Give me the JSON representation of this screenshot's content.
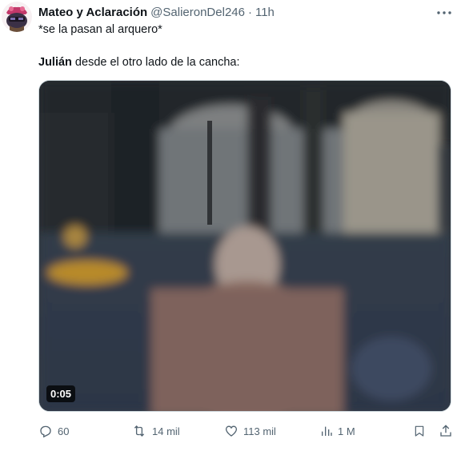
{
  "user": {
    "display_name": "Mateo y Aclaración",
    "handle": "@SalieronDel246",
    "separator": "·",
    "time": "11h"
  },
  "tweet": {
    "line1": "*se la pasan al arquero*",
    "line2_bold": "Julián",
    "line2_rest": " desde el otro lado de la cancha:"
  },
  "media": {
    "duration": "0:05"
  },
  "actions": {
    "replies": "60",
    "reposts": "14 mil",
    "likes": "113 mil",
    "views": "1 M"
  },
  "icons": {
    "more": "more-horizontal-icon",
    "reply": "reply-icon",
    "repost": "repost-icon",
    "like": "heart-icon",
    "views": "views-chart-icon",
    "bookmark": "bookmark-icon",
    "share": "share-icon"
  },
  "colors": {
    "text": "#0f1419",
    "muted": "#536471",
    "border": "#cfd9de"
  }
}
